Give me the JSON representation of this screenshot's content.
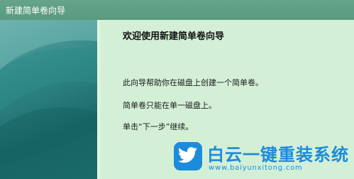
{
  "window": {
    "title": "新建简单卷向导"
  },
  "wizard": {
    "heading": "欢迎使用新建简单卷向导",
    "paragraphs": [
      "此向导帮助你在磁盘上创建一个简单卷。",
      "简单卷只能在单一磁盘上。",
      "单击“下一步”继续。"
    ]
  },
  "watermark": {
    "brand_text": "白云一键重装系统",
    "url_text": "www.baiyunxitong.com",
    "icon": "bird-icon",
    "color": "#1d8bdc"
  },
  "colors": {
    "title_bar": "#5a9a7e",
    "content_bg": "#d3f0d6",
    "side_panel": "#1a6a6a"
  }
}
